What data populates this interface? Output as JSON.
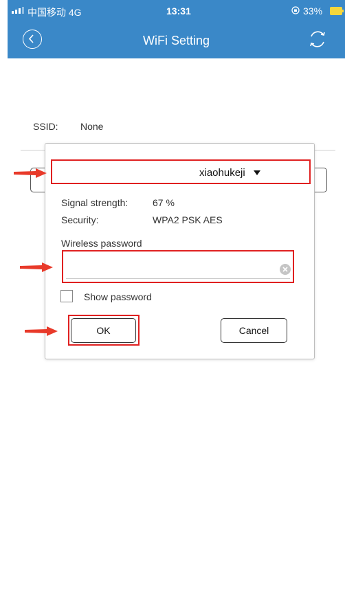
{
  "status_bar": {
    "carrier": "中国移动  4G",
    "time": "13:31",
    "battery": "33%"
  },
  "header": {
    "title": "WiFi Setting",
    "back_icon": "back-circle-icon",
    "refresh_icon": "refresh-icon"
  },
  "page": {
    "ssid_label": "SSID:",
    "ssid_value": "None"
  },
  "dialog": {
    "network_name": "xiaohukeji",
    "signal_label": "Signal strength:",
    "signal_value": "67 %",
    "security_label": "Security:",
    "security_value": "WPA2 PSK AES",
    "password_label": "Wireless password",
    "password_value": "",
    "show_password_label": "Show password",
    "show_password_checked": false,
    "ok_label": "OK",
    "cancel_label": "Cancel"
  },
  "colors": {
    "header_bg": "#3a88c8",
    "highlight": "#e02020",
    "battery": "#f5d63b"
  }
}
